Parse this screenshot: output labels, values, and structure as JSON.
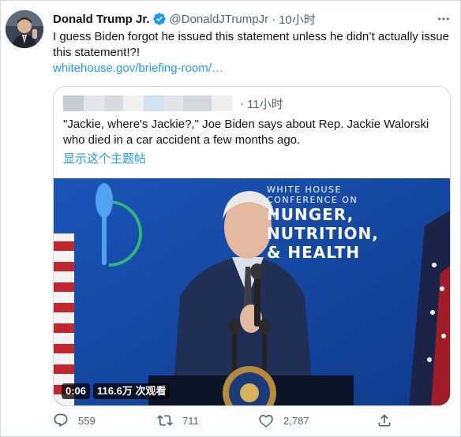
{
  "tweet": {
    "author_name": "Donald Trump Jr.",
    "handle": "@DonaldJTrumpJr",
    "separator": "·",
    "time": "10小时",
    "text": "I guess Biden forgot he issued this statement unless he didn’t actually issue this statement!?!",
    "link_text": "whitehouse.gov/briefing-room/…",
    "icons": {
      "verified": "verified-badge-icon",
      "more": "more-options-icon"
    }
  },
  "quote": {
    "separator": "·",
    "time": "11小时",
    "text": "\"Jackie, where's Jackie?,\" Joe Biden says about Rep. Jackie Walorski who died in a car accident a few months ago.",
    "show_thread": "显示这个主题帖",
    "video": {
      "banner_line1": "WHITE HOUSE",
      "banner_line2": "CONFERENCE ON",
      "banner_line3": "HUNGER,",
      "banner_line4": "NUTRITION,",
      "banner_line5": "& HEALTH",
      "duration": "0:06",
      "views": "116.6万 次观看"
    }
  },
  "actions": {
    "reply_count": "559",
    "retweet_count": "711",
    "like_count": "2,787",
    "icons": [
      "reply-icon",
      "retweet-icon",
      "like-icon",
      "share-icon"
    ]
  },
  "colors": {
    "link": "#1d9bf0",
    "secondary_text": "#536471",
    "border": "#cfd9de",
    "stage_blue": "#1548a8"
  }
}
